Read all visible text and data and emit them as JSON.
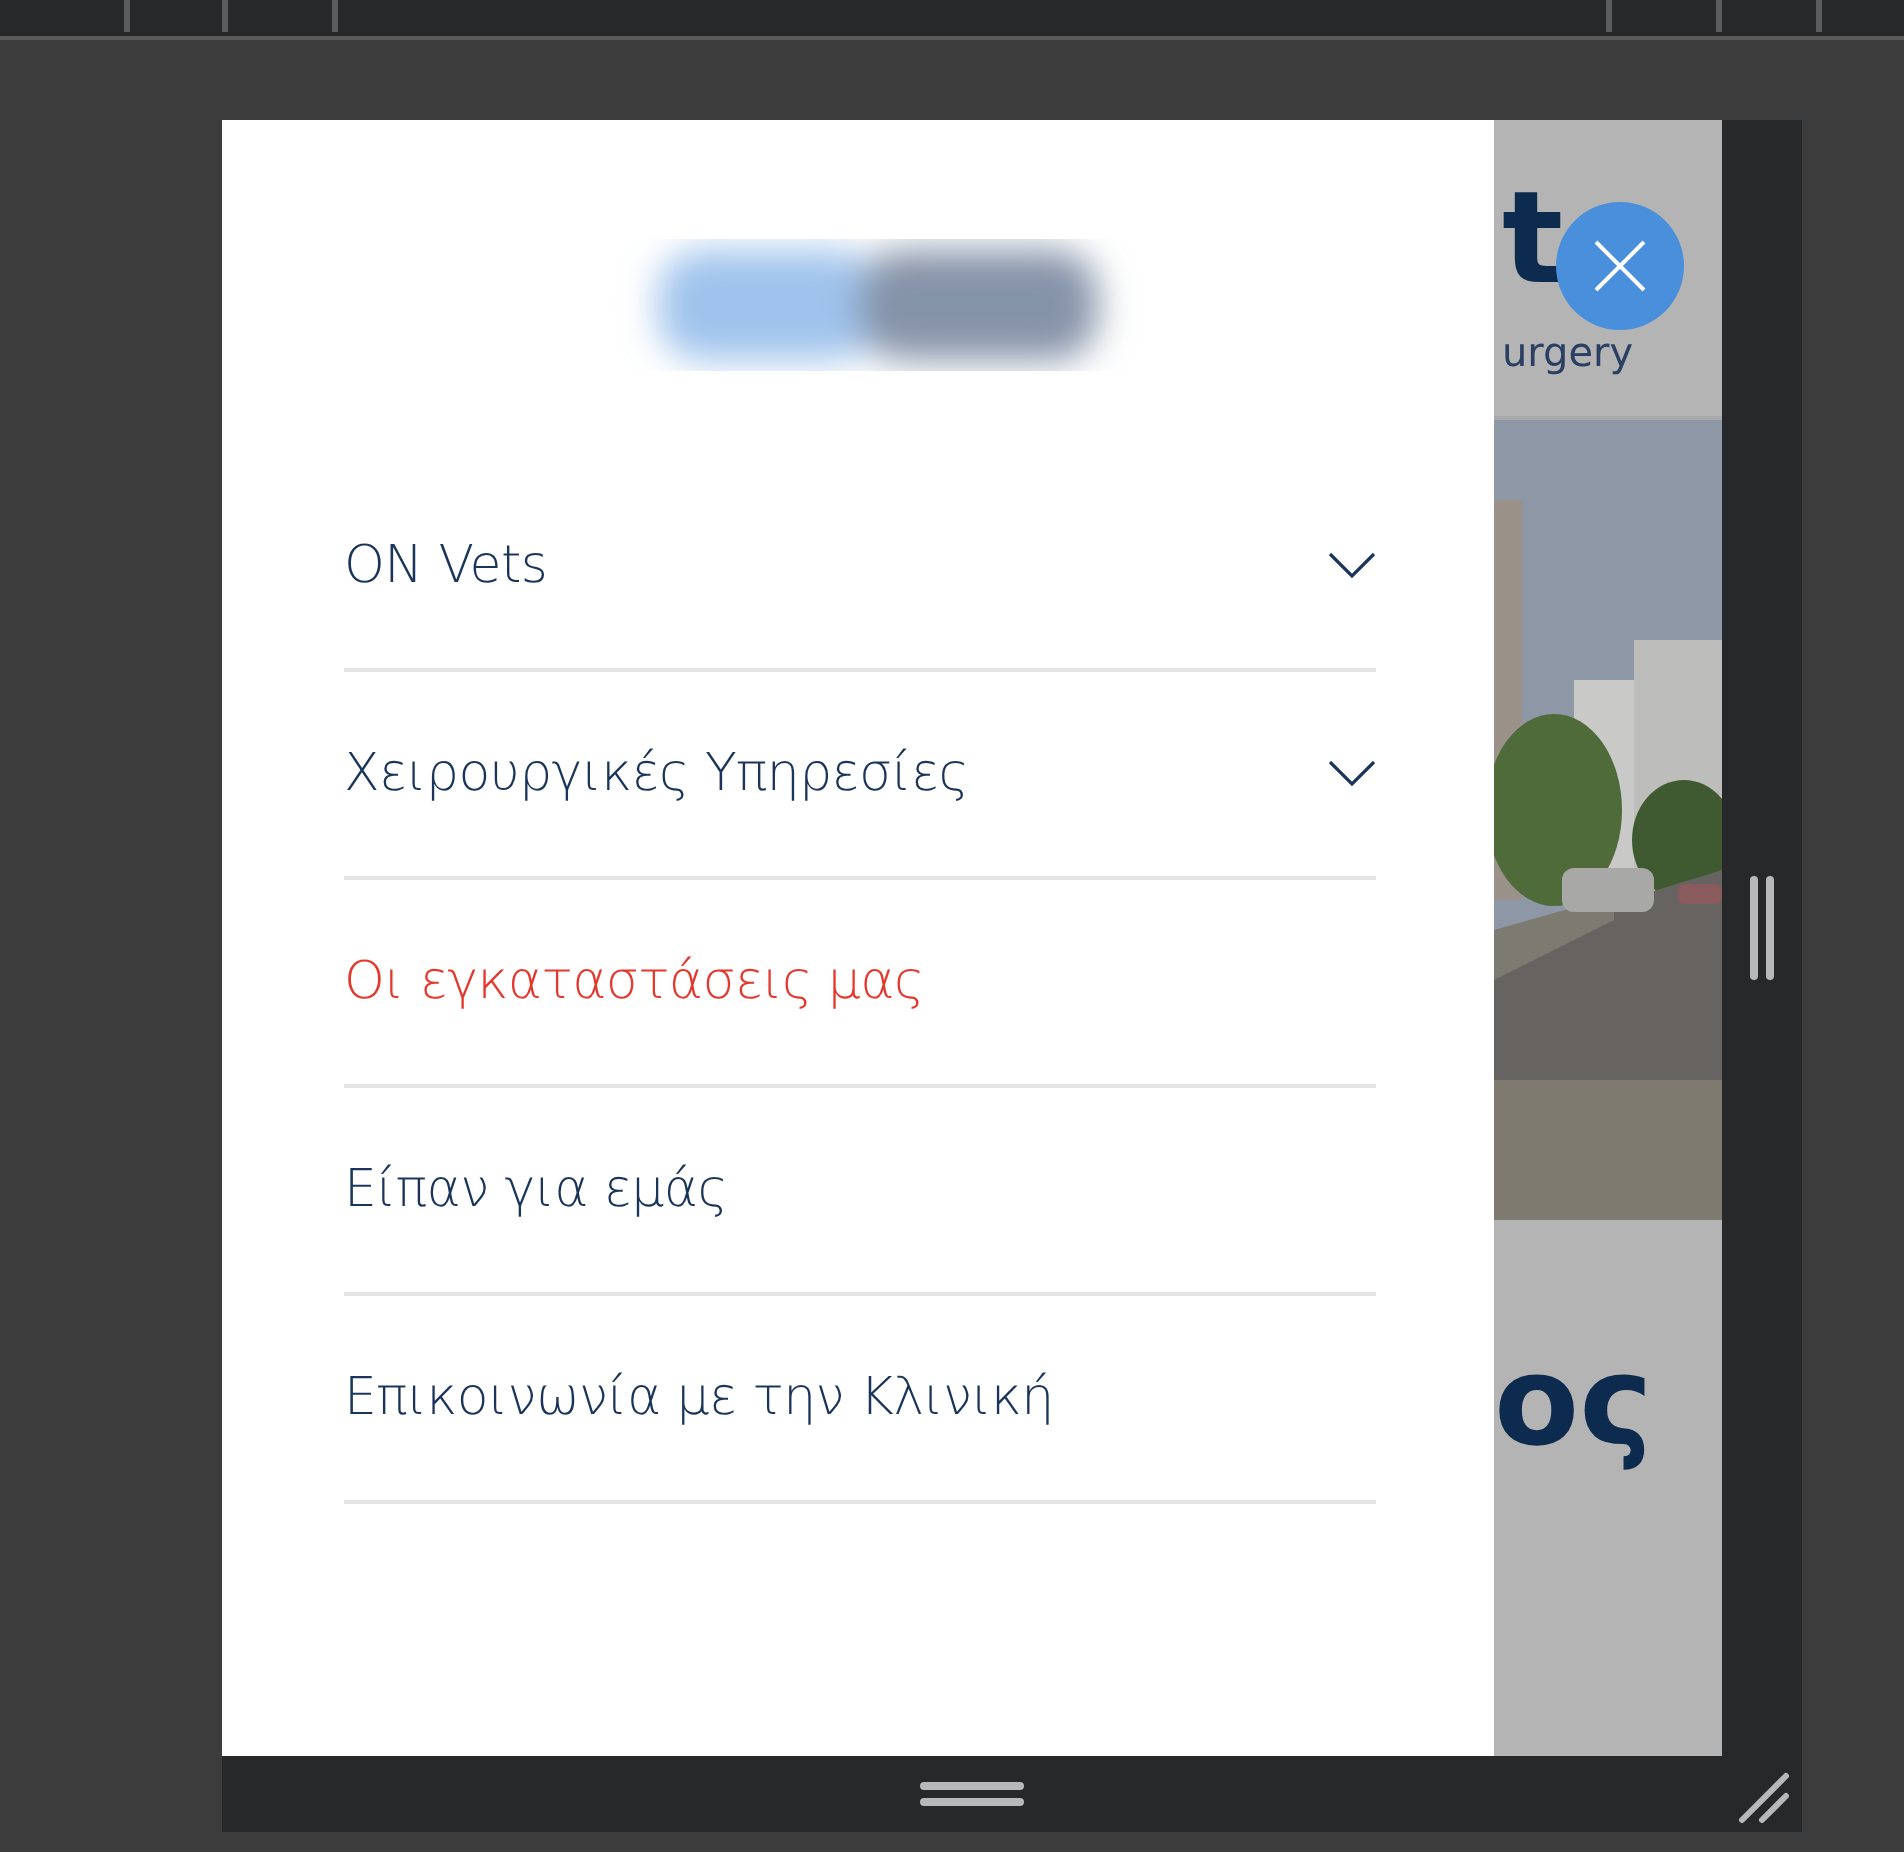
{
  "background_page": {
    "logo_fragment": "t",
    "tagline_fragment": "urgery",
    "heading_fragment": "ος"
  },
  "menu": {
    "items": [
      {
        "label": "ON Vets",
        "has_submenu": true,
        "selected": false
      },
      {
        "label": "Χειρουργικές Υπηρεσίες",
        "has_submenu": true,
        "selected": false
      },
      {
        "label": "Οι εγκαταστάσεις μας",
        "has_submenu": false,
        "selected": true
      },
      {
        "label": "Είπαν για εμάς",
        "has_submenu": false,
        "selected": false
      },
      {
        "label": "Επικοινωνία με την Κλινική",
        "has_submenu": false,
        "selected": false
      }
    ]
  }
}
